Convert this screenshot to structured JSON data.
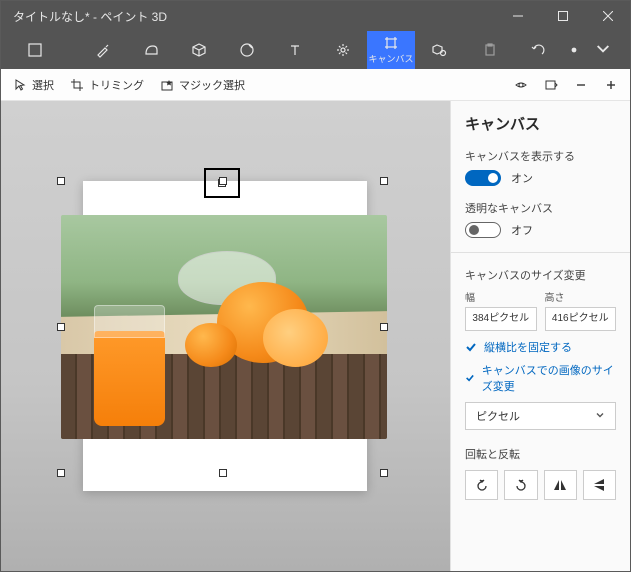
{
  "titlebar": {
    "title": "タイトルなし* - ペイント 3D"
  },
  "toolbar": {
    "canvas_label": "キャンバス"
  },
  "subtoolbar": {
    "select": "選択",
    "trimming": "トリミング",
    "magic_select": "マジック選択"
  },
  "panel": {
    "title": "キャンバス",
    "show_canvas_label": "キャンバスを表示する",
    "show_canvas_state": "オン",
    "transparent_label": "透明なキャンバス",
    "transparent_state": "オフ",
    "resize_title": "キャンバスのサイズ変更",
    "width_label": "幅",
    "height_label": "高さ",
    "width_value": "384ピクセル",
    "height_value": "416ピクセル",
    "lock_aspect": "縦横比を固定する",
    "resize_image": "キャンバスでの画像のサイズ変更",
    "unit": "ピクセル",
    "rotate_flip_title": "回転と反転"
  }
}
